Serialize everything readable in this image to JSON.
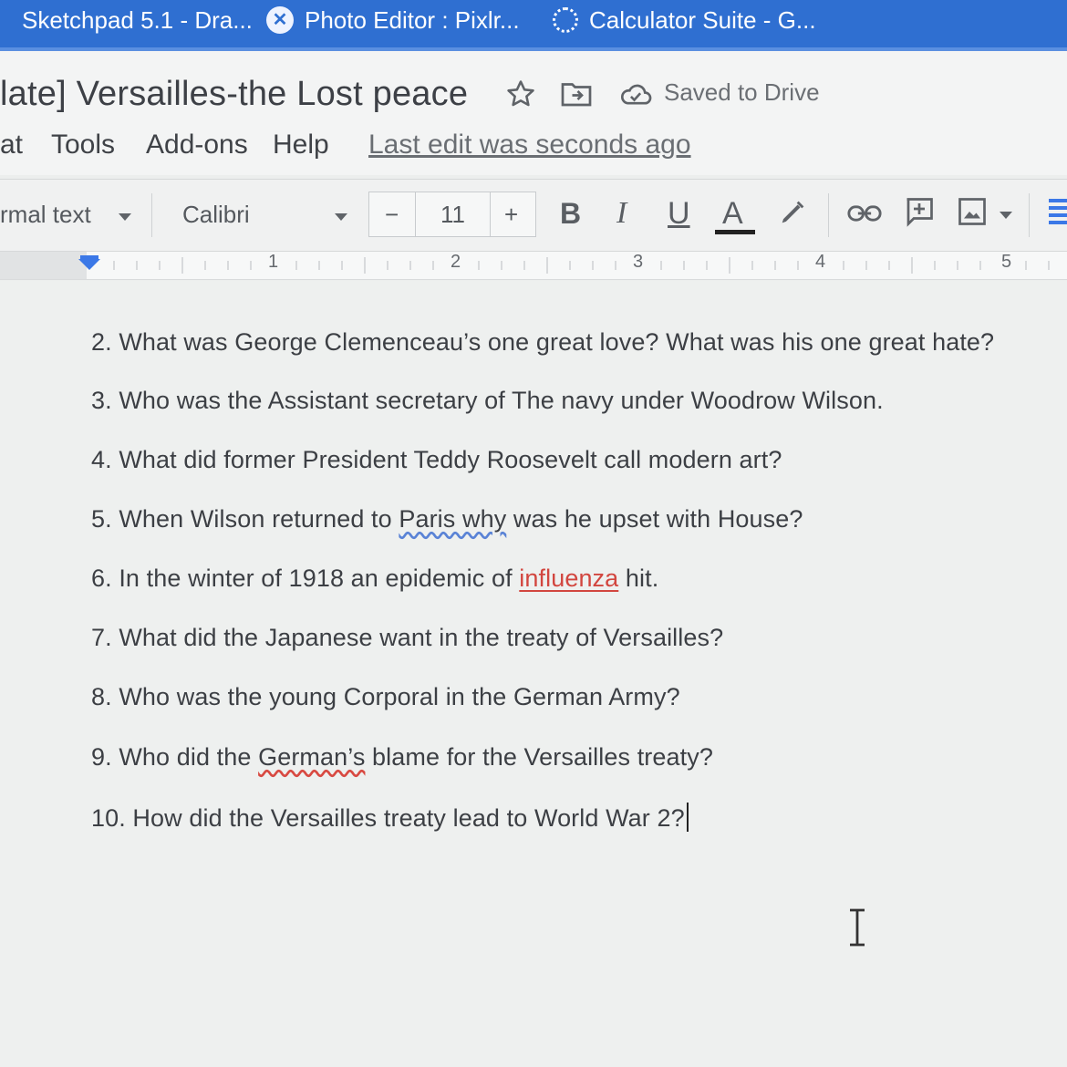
{
  "browser_tabs": [
    {
      "label": "Sketchpad 5.1 - Dra...",
      "icon": "sketchpad-icon"
    },
    {
      "label": "Photo Editor : Pixlr...",
      "icon": "pixlr-icon"
    },
    {
      "label": "Calculator Suite - G...",
      "icon": "loading-icon"
    }
  ],
  "doc": {
    "title": "late] Versailles-the Lost peace",
    "saved_status": "Saved to Drive",
    "last_edit": "Last edit was seconds ago"
  },
  "menu": {
    "items": [
      "at",
      "Tools",
      "Add-ons",
      "Help"
    ]
  },
  "toolbar": {
    "style": "rmal text",
    "font": "Calibri",
    "minus": "−",
    "font_size": "11",
    "plus": "+",
    "bold": "B",
    "italic": "I",
    "underline": "U",
    "text_color": "A"
  },
  "ruler": {
    "marks": [
      "1",
      "2",
      "3",
      "4",
      "5"
    ]
  },
  "questions": [
    {
      "text": "2. What was George Clemenceau’s one great love?  What was his one great hate?"
    },
    {
      "text": "3. Who was the Assistant secretary of The navy under Woodrow Wilson."
    },
    {
      "text": "4. What did former President Teddy Roosevelt call modern art?"
    },
    {
      "pre": "5. When Wilson returned to ",
      "mark": "Paris why",
      "post": " was he upset with House?"
    },
    {
      "pre": "6. In the winter of 1918 an epidemic of ",
      "mark": "influenza",
      "post": " hit."
    },
    {
      "text": "7. What did the Japanese want in the treaty of Versailles?"
    },
    {
      "text": "8. Who was the young Corporal in the German Army?"
    },
    {
      "pre": "9. Who did the ",
      "mark": "German’s",
      "post": " blame for the Versailles treaty?"
    },
    {
      "text": "10. How did the Versailles treaty lead to World War 2?"
    }
  ],
  "colors": {
    "tab_bar": "#2f6fd1",
    "accent_blue": "#3b78e7",
    "spell_red": "#d2463f"
  }
}
